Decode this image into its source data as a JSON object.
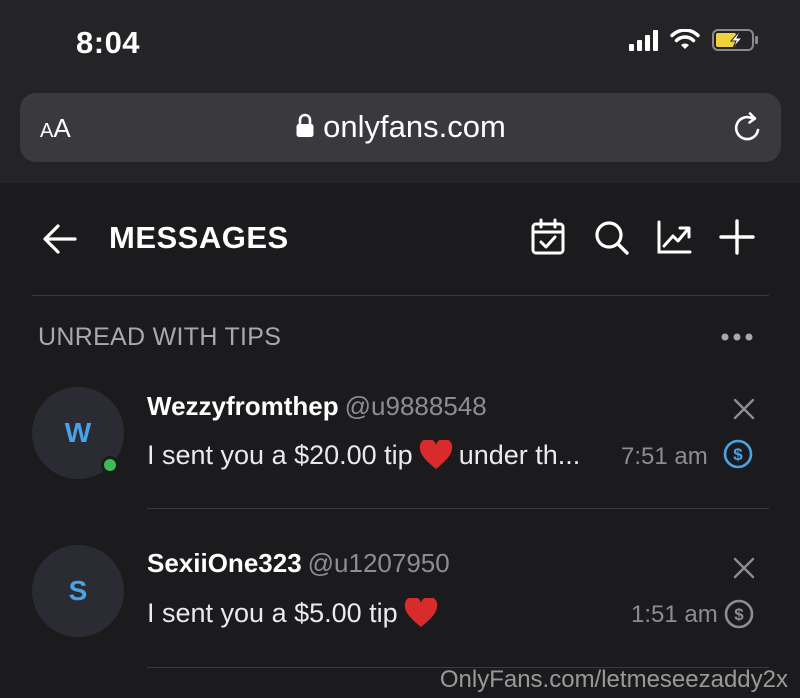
{
  "status_bar": {
    "time": "8:04"
  },
  "browser": {
    "aa_small": "A",
    "aa_large": "A",
    "url": "onlyfans.com"
  },
  "header": {
    "title": "MESSAGES"
  },
  "section": {
    "title": "UNREAD WITH TIPS"
  },
  "messages": [
    {
      "avatar_letter": "W",
      "name": "Wezzyfromthep",
      "handle": "@u9888548",
      "preview_before": "I sent you a $20.00 tip",
      "preview_after": "under th...",
      "time": "7:51 am",
      "online": true
    },
    {
      "avatar_letter": "S",
      "name": "SexiiOne323",
      "handle": "@u1207950",
      "preview_before": "I sent you a $5.00 tip",
      "preview_after": "",
      "time": "1:51 am",
      "online": false
    }
  ],
  "watermark": "OnlyFans.com/letmeseezaddy2x",
  "colors": {
    "accent": "#4aa3e7",
    "online": "#3cba54",
    "heart": "#d92b2b",
    "battery": "#f2d23c"
  },
  "icons": [
    "signal-icon",
    "wifi-icon",
    "battery-charging-icon",
    "lock-icon",
    "reload-icon",
    "back-arrow-icon",
    "calendar-check-icon",
    "search-icon",
    "statistics-icon",
    "plus-icon",
    "more-dots-icon",
    "close-icon",
    "dollar-coin-icon",
    "heart-icon"
  ]
}
